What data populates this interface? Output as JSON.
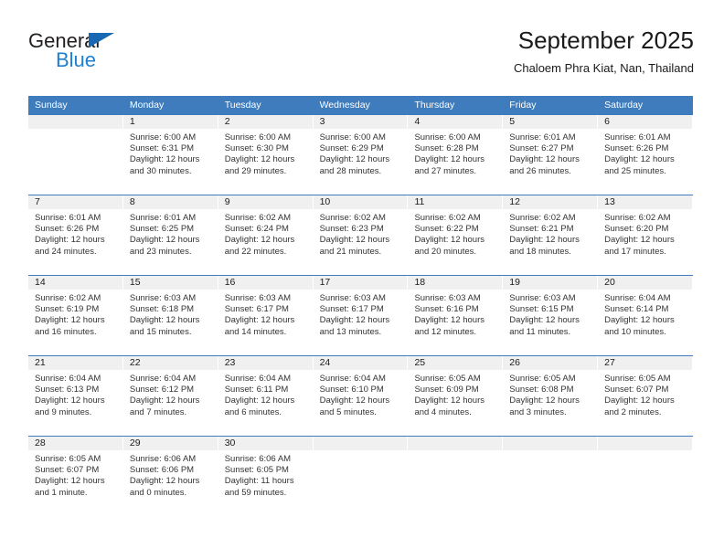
{
  "brand": {
    "name_part1": "General",
    "name_part2": "Blue",
    "triangle_color": "#1767b2",
    "blue_color": "#1f7fd0"
  },
  "header": {
    "title": "September 2025",
    "subtitle": "Chaloem Phra Kiat, Nan, Thailand"
  },
  "theme": {
    "header_bg": "#3e7cbd",
    "daynum_bg": "#f0f0f0",
    "cell_bg": "#ffffff",
    "rule_color": "#3e7cbd"
  },
  "weekdays": [
    "Sunday",
    "Monday",
    "Tuesday",
    "Wednesday",
    "Thursday",
    "Friday",
    "Saturday"
  ],
  "weeks": [
    [
      {
        "day": "",
        "sunrise": "",
        "sunset": "",
        "daylight1": "",
        "daylight2": ""
      },
      {
        "day": "1",
        "sunrise": "Sunrise: 6:00 AM",
        "sunset": "Sunset: 6:31 PM",
        "daylight1": "Daylight: 12 hours",
        "daylight2": "and 30 minutes."
      },
      {
        "day": "2",
        "sunrise": "Sunrise: 6:00 AM",
        "sunset": "Sunset: 6:30 PM",
        "daylight1": "Daylight: 12 hours",
        "daylight2": "and 29 minutes."
      },
      {
        "day": "3",
        "sunrise": "Sunrise: 6:00 AM",
        "sunset": "Sunset: 6:29 PM",
        "daylight1": "Daylight: 12 hours",
        "daylight2": "and 28 minutes."
      },
      {
        "day": "4",
        "sunrise": "Sunrise: 6:00 AM",
        "sunset": "Sunset: 6:28 PM",
        "daylight1": "Daylight: 12 hours",
        "daylight2": "and 27 minutes."
      },
      {
        "day": "5",
        "sunrise": "Sunrise: 6:01 AM",
        "sunset": "Sunset: 6:27 PM",
        "daylight1": "Daylight: 12 hours",
        "daylight2": "and 26 minutes."
      },
      {
        "day": "6",
        "sunrise": "Sunrise: 6:01 AM",
        "sunset": "Sunset: 6:26 PM",
        "daylight1": "Daylight: 12 hours",
        "daylight2": "and 25 minutes."
      }
    ],
    [
      {
        "day": "7",
        "sunrise": "Sunrise: 6:01 AM",
        "sunset": "Sunset: 6:26 PM",
        "daylight1": "Daylight: 12 hours",
        "daylight2": "and 24 minutes."
      },
      {
        "day": "8",
        "sunrise": "Sunrise: 6:01 AM",
        "sunset": "Sunset: 6:25 PM",
        "daylight1": "Daylight: 12 hours",
        "daylight2": "and 23 minutes."
      },
      {
        "day": "9",
        "sunrise": "Sunrise: 6:02 AM",
        "sunset": "Sunset: 6:24 PM",
        "daylight1": "Daylight: 12 hours",
        "daylight2": "and 22 minutes."
      },
      {
        "day": "10",
        "sunrise": "Sunrise: 6:02 AM",
        "sunset": "Sunset: 6:23 PM",
        "daylight1": "Daylight: 12 hours",
        "daylight2": "and 21 minutes."
      },
      {
        "day": "11",
        "sunrise": "Sunrise: 6:02 AM",
        "sunset": "Sunset: 6:22 PM",
        "daylight1": "Daylight: 12 hours",
        "daylight2": "and 20 minutes."
      },
      {
        "day": "12",
        "sunrise": "Sunrise: 6:02 AM",
        "sunset": "Sunset: 6:21 PM",
        "daylight1": "Daylight: 12 hours",
        "daylight2": "and 18 minutes."
      },
      {
        "day": "13",
        "sunrise": "Sunrise: 6:02 AM",
        "sunset": "Sunset: 6:20 PM",
        "daylight1": "Daylight: 12 hours",
        "daylight2": "and 17 minutes."
      }
    ],
    [
      {
        "day": "14",
        "sunrise": "Sunrise: 6:02 AM",
        "sunset": "Sunset: 6:19 PM",
        "daylight1": "Daylight: 12 hours",
        "daylight2": "and 16 minutes."
      },
      {
        "day": "15",
        "sunrise": "Sunrise: 6:03 AM",
        "sunset": "Sunset: 6:18 PM",
        "daylight1": "Daylight: 12 hours",
        "daylight2": "and 15 minutes."
      },
      {
        "day": "16",
        "sunrise": "Sunrise: 6:03 AM",
        "sunset": "Sunset: 6:17 PM",
        "daylight1": "Daylight: 12 hours",
        "daylight2": "and 14 minutes."
      },
      {
        "day": "17",
        "sunrise": "Sunrise: 6:03 AM",
        "sunset": "Sunset: 6:17 PM",
        "daylight1": "Daylight: 12 hours",
        "daylight2": "and 13 minutes."
      },
      {
        "day": "18",
        "sunrise": "Sunrise: 6:03 AM",
        "sunset": "Sunset: 6:16 PM",
        "daylight1": "Daylight: 12 hours",
        "daylight2": "and 12 minutes."
      },
      {
        "day": "19",
        "sunrise": "Sunrise: 6:03 AM",
        "sunset": "Sunset: 6:15 PM",
        "daylight1": "Daylight: 12 hours",
        "daylight2": "and 11 minutes."
      },
      {
        "day": "20",
        "sunrise": "Sunrise: 6:04 AM",
        "sunset": "Sunset: 6:14 PM",
        "daylight1": "Daylight: 12 hours",
        "daylight2": "and 10 minutes."
      }
    ],
    [
      {
        "day": "21",
        "sunrise": "Sunrise: 6:04 AM",
        "sunset": "Sunset: 6:13 PM",
        "daylight1": "Daylight: 12 hours",
        "daylight2": "and 9 minutes."
      },
      {
        "day": "22",
        "sunrise": "Sunrise: 6:04 AM",
        "sunset": "Sunset: 6:12 PM",
        "daylight1": "Daylight: 12 hours",
        "daylight2": "and 7 minutes."
      },
      {
        "day": "23",
        "sunrise": "Sunrise: 6:04 AM",
        "sunset": "Sunset: 6:11 PM",
        "daylight1": "Daylight: 12 hours",
        "daylight2": "and 6 minutes."
      },
      {
        "day": "24",
        "sunrise": "Sunrise: 6:04 AM",
        "sunset": "Sunset: 6:10 PM",
        "daylight1": "Daylight: 12 hours",
        "daylight2": "and 5 minutes."
      },
      {
        "day": "25",
        "sunrise": "Sunrise: 6:05 AM",
        "sunset": "Sunset: 6:09 PM",
        "daylight1": "Daylight: 12 hours",
        "daylight2": "and 4 minutes."
      },
      {
        "day": "26",
        "sunrise": "Sunrise: 6:05 AM",
        "sunset": "Sunset: 6:08 PM",
        "daylight1": "Daylight: 12 hours",
        "daylight2": "and 3 minutes."
      },
      {
        "day": "27",
        "sunrise": "Sunrise: 6:05 AM",
        "sunset": "Sunset: 6:07 PM",
        "daylight1": "Daylight: 12 hours",
        "daylight2": "and 2 minutes."
      }
    ],
    [
      {
        "day": "28",
        "sunrise": "Sunrise: 6:05 AM",
        "sunset": "Sunset: 6:07 PM",
        "daylight1": "Daylight: 12 hours",
        "daylight2": "and 1 minute."
      },
      {
        "day": "29",
        "sunrise": "Sunrise: 6:06 AM",
        "sunset": "Sunset: 6:06 PM",
        "daylight1": "Daylight: 12 hours",
        "daylight2": "and 0 minutes."
      },
      {
        "day": "30",
        "sunrise": "Sunrise: 6:06 AM",
        "sunset": "Sunset: 6:05 PM",
        "daylight1": "Daylight: 11 hours",
        "daylight2": "and 59 minutes."
      },
      {
        "day": "",
        "sunrise": "",
        "sunset": "",
        "daylight1": "",
        "daylight2": ""
      },
      {
        "day": "",
        "sunrise": "",
        "sunset": "",
        "daylight1": "",
        "daylight2": ""
      },
      {
        "day": "",
        "sunrise": "",
        "sunset": "",
        "daylight1": "",
        "daylight2": ""
      },
      {
        "day": "",
        "sunrise": "",
        "sunset": "",
        "daylight1": "",
        "daylight2": ""
      }
    ]
  ]
}
